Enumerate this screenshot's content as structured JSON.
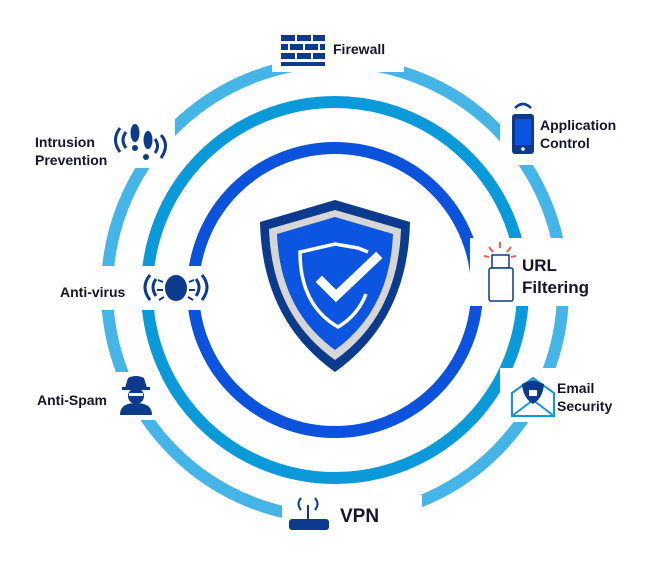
{
  "colors": {
    "outer_ring": "#45b4e6",
    "middle_ring": "#0a9ad9",
    "inner_ring": "#0b52dc",
    "shield_dark": "#0c3a8c",
    "shield_fill": "#0b55e0",
    "icon": "#0c3a8c"
  },
  "center": {
    "icon": "shield-check-icon"
  },
  "features": [
    {
      "label": "Firewall",
      "icon": "brick-wall-icon"
    },
    {
      "label_line1": "Application",
      "label_line2": "Control",
      "icon": "mobile-phone-icon"
    },
    {
      "label_line1": "URL",
      "label_line2": "Filtering",
      "icon": "usb-drive-icon"
    },
    {
      "label_line1": "Email",
      "label_line2": "Security",
      "icon": "secure-email-icon"
    },
    {
      "label": "VPN",
      "icon": "router-icon"
    },
    {
      "label": "Anti-Spam",
      "icon": "spy-icon"
    },
    {
      "label": "Anti-virus",
      "icon": "bug-icon"
    },
    {
      "label_line1": "Intrusion",
      "label_line2": "Prevention",
      "icon": "footprints-icon"
    }
  ]
}
